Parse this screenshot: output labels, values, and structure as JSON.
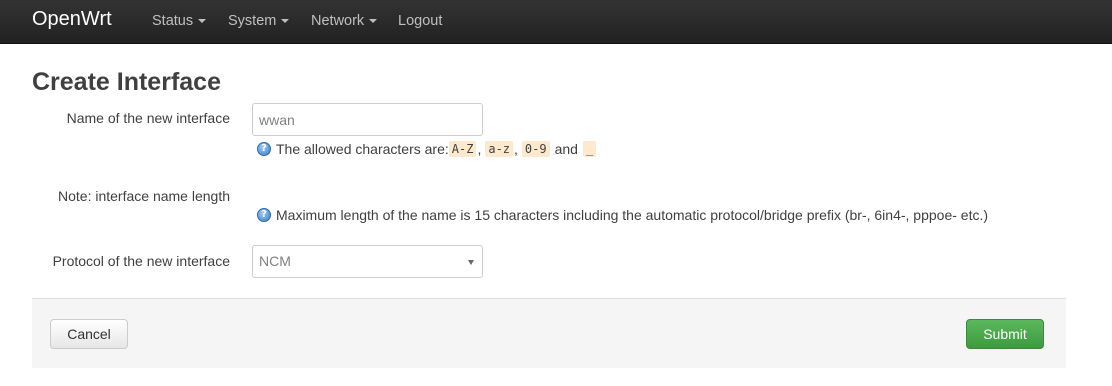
{
  "navbar": {
    "brand": "OpenWrt",
    "items": [
      {
        "label": "Status"
      },
      {
        "label": "System"
      },
      {
        "label": "Network"
      },
      {
        "label": "Logout"
      }
    ]
  },
  "page": {
    "title": "Create Interface"
  },
  "form": {
    "name": {
      "label": "Name of the new interface",
      "value": "wwan",
      "help_prefix": "The allowed characters are: ",
      "chars": [
        "A-Z",
        "a-z",
        "0-9",
        "_"
      ],
      "comma": ",",
      "and": "and"
    },
    "note": {
      "label": "Note: interface name length",
      "help": "Maximum length of the name is 15 characters including the automatic protocol/bridge prefix (br-, 6in4-, pppoe- etc.)"
    },
    "protocol": {
      "label": "Protocol of the new interface",
      "selected": "NCM"
    }
  },
  "actions": {
    "cancel_label": "Cancel",
    "submit_label": "Submit"
  },
  "help_icon_glyph": "?",
  "colors": {
    "navbar": "#222222",
    "submit": "#4cae4c",
    "code_bg": "#fee9cc"
  }
}
